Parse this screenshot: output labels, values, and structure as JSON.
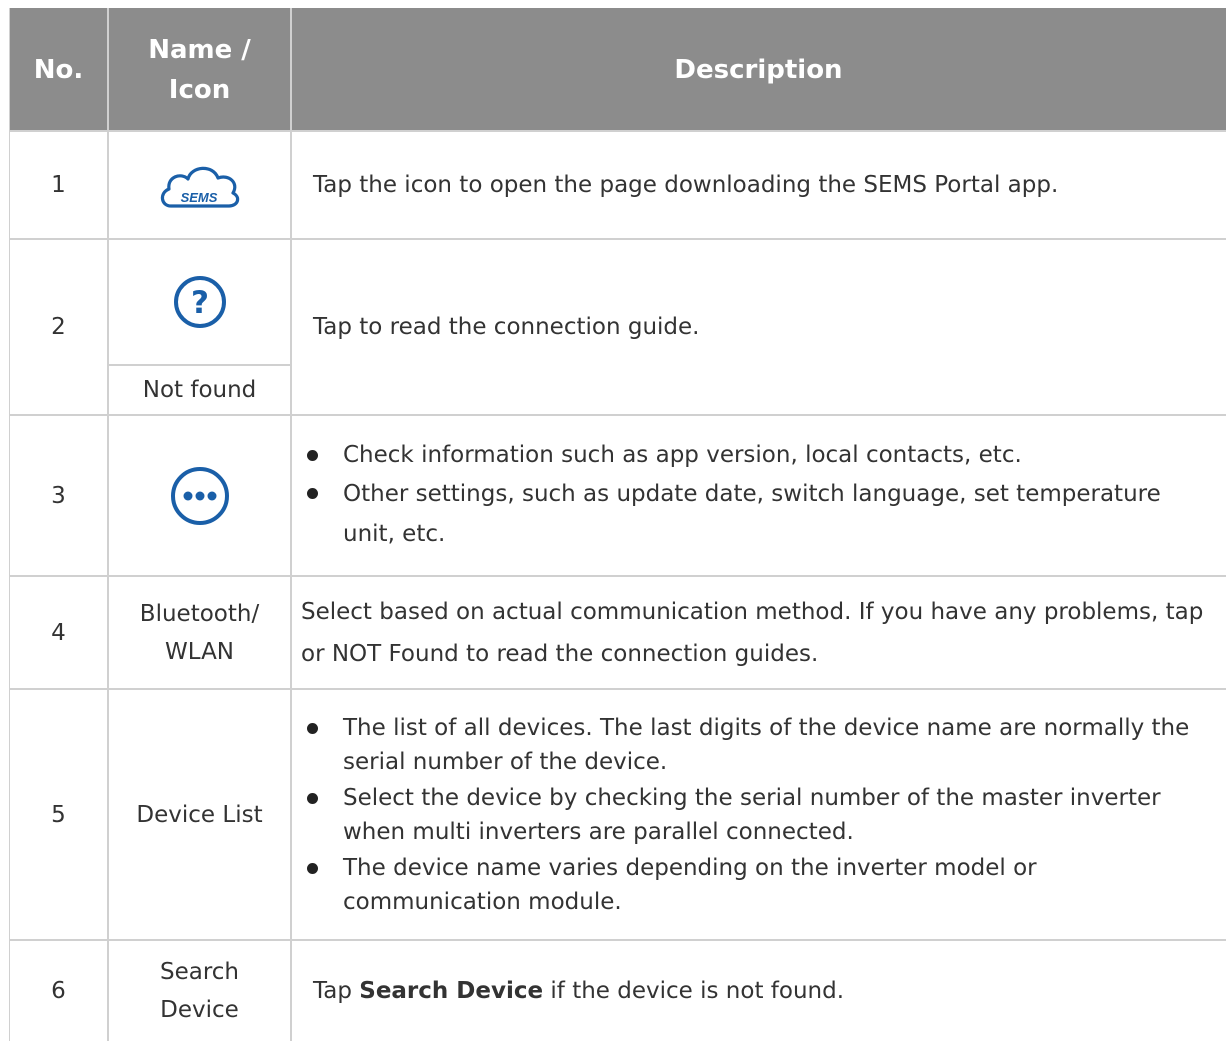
{
  "header": {
    "no": "No.",
    "name_icon_line1": "Name /",
    "name_icon_line2": "Icon",
    "description": "Description"
  },
  "colors": {
    "header_bg": "#8c8c8c",
    "border": "#d0d0d0",
    "icon_blue": "#1a5fa8"
  },
  "rows": [
    {
      "no": "1",
      "icon": "sems-cloud-icon",
      "icon_text": "SEMS",
      "description": "Tap the icon to open the page downloading the SEMS Portal app."
    },
    {
      "no": "2",
      "icon": "question-circle-icon",
      "icon_glyph": "?",
      "name": "Not found",
      "description": "Tap to read the connection guide."
    },
    {
      "no": "3",
      "icon": "more-dots-icon",
      "bullets": [
        "Check information such as app version, local contacts, etc.",
        "Other settings, such as update date, switch language, set temperature unit, etc."
      ]
    },
    {
      "no": "4",
      "name_line1": "Bluetooth/",
      "name_line2": "WLAN",
      "description": "Select based on actual communication method. If you have any problems, tap or NOT Found to read the connection guides."
    },
    {
      "no": "5",
      "name": "Device List",
      "bullets": [
        "The list of all devices. The last digits of the device name are normally the serial number of the device.",
        "Select the device by checking the serial number of the master inverter when multi inverters are parallel connected.",
        "The device name varies depending on the inverter model or communication module."
      ]
    },
    {
      "no": "6",
      "name_line1": "Search",
      "name_line2": "Device",
      "desc_prefix": "Tap ",
      "desc_bold": "Search Device",
      "desc_suffix": " if the device is not found."
    }
  ]
}
